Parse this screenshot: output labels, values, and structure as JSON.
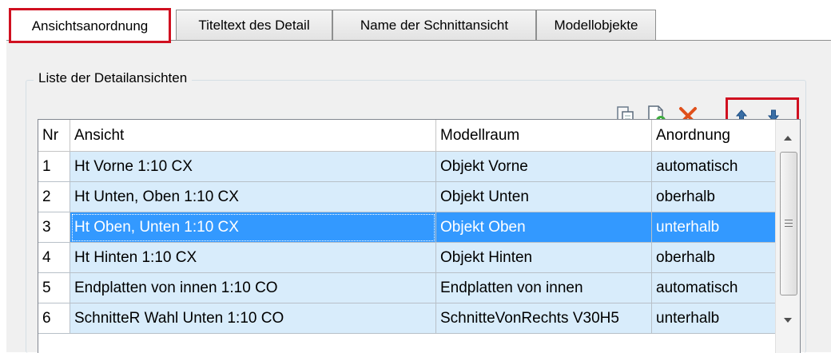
{
  "tabs": [
    {
      "label": "Ansichtsanordnung",
      "active": true
    },
    {
      "label": "Titeltext des Detail",
      "active": false
    },
    {
      "label": "Name der Schnittansicht",
      "active": false
    },
    {
      "label": "Modellobjekte",
      "active": false
    }
  ],
  "group": {
    "title": "Liste der Detailansichten"
  },
  "toolbar": {
    "icons": [
      "copy-icon",
      "add-document-icon",
      "delete-icon",
      "move-up-icon",
      "move-down-icon"
    ],
    "highlight_color": "#d01020"
  },
  "table": {
    "columns": [
      "Nr",
      "Ansicht",
      "Modellraum",
      "Anordnung"
    ],
    "rows": [
      {
        "nr": "1",
        "ansicht": "Ht Vorne 1:10 CX",
        "modellraum": "Objekt Vorne",
        "anordnung": "automatisch"
      },
      {
        "nr": "2",
        "ansicht": "Ht Unten, Oben 1:10 CX",
        "modellraum": "Objekt Unten",
        "anordnung": "oberhalb"
      },
      {
        "nr": "3",
        "ansicht": "Ht Oben, Unten 1:10 CX",
        "modellraum": "Objekt Oben",
        "anordnung": "unterhalb"
      },
      {
        "nr": "4",
        "ansicht": "Ht Hinten 1:10 CX",
        "modellraum": "Objekt Hinten",
        "anordnung": "oberhalb"
      },
      {
        "nr": "5",
        "ansicht": "Endplatten von innen 1:10 CO",
        "modellraum": "Endplatten von innen",
        "anordnung": "automatisch"
      },
      {
        "nr": "6",
        "ansicht": "SchnitteR Wahl Unten 1:10 CO",
        "modellraum": "SchnitteVonRechts V30H5",
        "anordnung": "unterhalb"
      }
    ],
    "selected_row": 3,
    "selection_color": "#3399ff",
    "row_color": "#d8ecfb"
  }
}
